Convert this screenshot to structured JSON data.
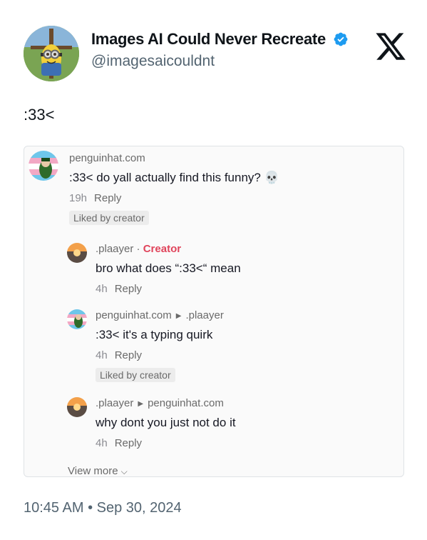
{
  "tweet": {
    "display_name": "Images AI Could Never Recreate",
    "handle": "@imagesaicouldnt",
    "text": ":33<",
    "timestamp": "10:45 AM",
    "separator": "•",
    "date": "Sep 30, 2024",
    "verified_icon": "verified-badge-icon",
    "logo_icon": "x-logo-icon"
  },
  "embed": {
    "comments": [
      {
        "user": "penguinhat.com",
        "text": ":33< do yall actually find this funny? 💀",
        "time": "19h",
        "reply": "Reply",
        "liked": "Liked by creator"
      },
      {
        "user": ".plaayer",
        "dot": "·",
        "badge": "Creator",
        "text": "bro what does “:33<“ mean",
        "time": "4h",
        "reply": "Reply"
      },
      {
        "user": "penguinhat.com",
        "reply_to": ".plaayer",
        "text": ":33< it's a typing quirk",
        "time": "4h",
        "reply": "Reply",
        "liked": "Liked by creator"
      },
      {
        "user": ".plaayer",
        "reply_to": "penguinhat.com",
        "text": "why dont you just not do it",
        "time": "4h",
        "reply": "Reply"
      }
    ],
    "view_more": "View more",
    "reply_arrow_icon": "triangle-right-icon",
    "chevron_icon": "chevron-down-icon"
  },
  "colors": {
    "verified": "#1d9bf0",
    "creator_badge": "#e0445b",
    "secondary_text": "#536471"
  }
}
